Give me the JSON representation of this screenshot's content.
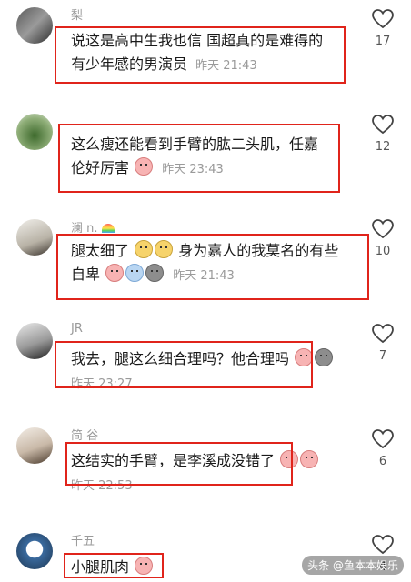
{
  "comments": [
    {
      "username": "梨",
      "text_line1": "说这是高中生我也信 国超真的是难得的",
      "text_line2": "有少年感的男演员",
      "time": "昨天 21:43",
      "likes": "17"
    },
    {
      "username": "",
      "text_line1": "这么瘦还能看到手臂的肱二头肌，任嘉",
      "text_line2": "伦好厉害",
      "time": "昨天 23:43",
      "likes": "12"
    },
    {
      "username": "澜 n.",
      "text_line1": "腿太细了",
      "text_line1b": "身为嘉人的我莫名的有些",
      "text_line2": "自卑",
      "time": "昨天 21:43",
      "likes": "10"
    },
    {
      "username": "JR",
      "text_line1": "我去，腿这么细合理吗？他合理吗",
      "time": "昨天 23:27",
      "likes": "7"
    },
    {
      "username": "简 谷",
      "text_line1": "这结实的手臂，是李溪成没错了",
      "time": "昨天 22:53",
      "likes": "6"
    },
    {
      "username": "千五",
      "text_line1": "小腿肌肉",
      "time": "",
      "likes": "4"
    }
  ],
  "watermark": "头条 @鱼本本娱乐",
  "icon_names": [
    "heart-icon",
    "emoji-sticker-icon",
    "avatar"
  ],
  "colors": {
    "highlight": "#e0241b",
    "meta_text": "#9a9a9a"
  }
}
